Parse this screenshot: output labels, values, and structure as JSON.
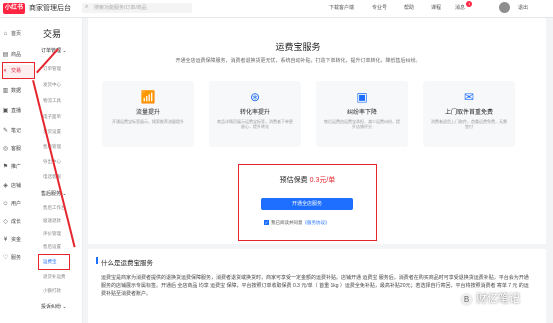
{
  "topbar": {
    "logo": "小红书",
    "app_title": "商家管理后台",
    "search_placeholder": "搜索功能服务/订单/商品",
    "links": [
      "下载客户端",
      "专业号",
      "帮助",
      "课程",
      "消息",
      "退出"
    ],
    "notification_count": "1"
  },
  "nav_primary": {
    "items": [
      {
        "icon": "⌂",
        "label": "首页"
      },
      {
        "icon": "▤",
        "label": "商品"
      },
      {
        "icon": "◐",
        "label": "交易"
      },
      {
        "icon": "▥",
        "label": "数据"
      },
      {
        "icon": "▣",
        "label": "直播"
      },
      {
        "icon": "✎",
        "label": "笔记"
      },
      {
        "icon": "◎",
        "label": "客服"
      },
      {
        "icon": "⚑",
        "label": "推广"
      },
      {
        "icon": "◈",
        "label": "店铺"
      },
      {
        "icon": "☺",
        "label": "用户"
      },
      {
        "icon": "◇",
        "label": "成长"
      },
      {
        "icon": "¥",
        "label": "资金"
      },
      {
        "icon": "♡",
        "label": "服务"
      }
    ]
  },
  "nav_secondary": {
    "title": "交易",
    "groups": [
      {
        "label": "订单管理 ⌄",
        "items": [
          "订单管理",
          "发货中心",
          "物流工具",
          "电子面单",
          "发货设置",
          "售后管理",
          "导出中心",
          "电话客服"
        ]
      },
      {
        "label": "售后服务 ⌄",
        "items": [
          "售后工作台",
          "极速退款",
          "评价管理",
          "售后设置",
          "运费宝",
          "退货补运费",
          "小额打款"
        ]
      },
      {
        "label": "投诉纠纷 ⌄",
        "items": []
      }
    ]
  },
  "hero": {
    "title": "运费宝服务",
    "subtitle": "开通全店运费保障服务，消费者退换货更无忧，系统自动补贴，打造下单转化，提升订单转化，降低售后纠纷。",
    "cards": [
      {
        "icon": "chart-growth-icon",
        "glyph": "📶",
        "title": "流量提升",
        "desc": "开通运费宝标签展示，搜索推荐流量提升"
      },
      {
        "icon": "conversion-icon",
        "glyph": "⊛",
        "title": "转化率提升",
        "desc": "商品详情页展示运费宝标签，消费者下单更放心，提升转化"
      },
      {
        "icon": "dispute-icon",
        "glyph": "▣",
        "title": "纠纷率下降",
        "desc": "售后运费由运费宝承担，减少运费纠纷，提升店铺评分"
      },
      {
        "icon": "free-shipping-icon",
        "glyph": "✉",
        "title": "上门取件首重免费",
        "desc": "消费者退货上门取件，首重运费免费，无需垫付"
      }
    ]
  },
  "pricing": {
    "label": "预估保费",
    "amount": "0.3元/单",
    "button": "开通全店服务",
    "agree_text": "我已阅读并同意",
    "agree_link": "《服务协议》"
  },
  "intro": {
    "title": "什么是运费宝服务",
    "body": "运费宝是商家为消费者提供的退换货运费保障服务，消费者退货或换货时，商家可享受一定金额的运费补贴。店铺开通 运费宝 服务后，消费者在购买商品时可享受退换货运费补贴，平台会为开通服务的店铺展示专属标签。开通后 全店商品 均享 运费宝 保障，平台按照订单收取保费 0.3 元/单（ 首重 1kg ）运费全免补贴，最高补贴20元；若选择自行寄回，平台将按照消费者 寄单 7 元 的运费补贴至消费者账户。"
  },
  "watermark": {
    "badge": "B",
    "text": "财亿笔记"
  }
}
